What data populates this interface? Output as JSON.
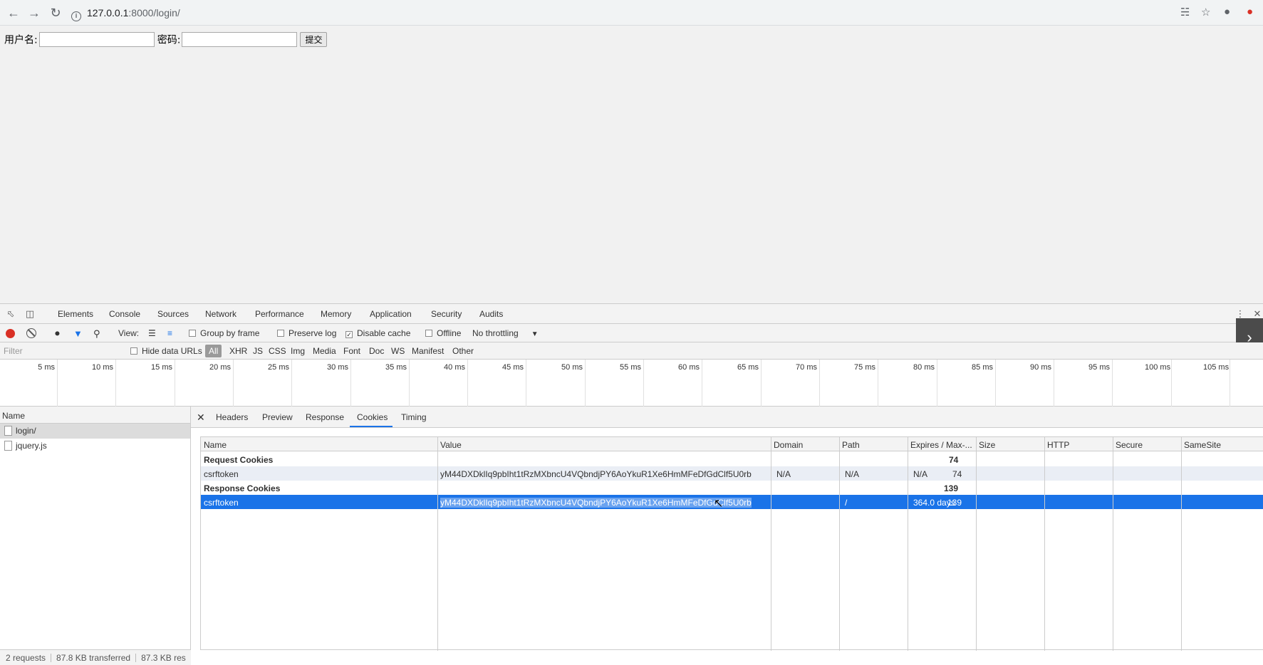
{
  "browser": {
    "url_host": "127.0.0.1",
    "url_path": ":8000/login/"
  },
  "login_form": {
    "username_label": "用户名:",
    "password_label": "密码:",
    "submit_label": "提交"
  },
  "devtools": {
    "tabs": [
      "Elements",
      "Console",
      "Sources",
      "Network",
      "Performance",
      "Memory",
      "Application",
      "Security",
      "Audits"
    ],
    "active_tab": "Network",
    "toolbar": {
      "view_label": "View:",
      "group_by_frame": "Group by frame",
      "preserve_log": "Preserve log",
      "disable_cache": "Disable cache",
      "disable_cache_checked": true,
      "offline": "Offline",
      "throttling": "No throttling"
    },
    "filter": {
      "placeholder": "Filter",
      "hide_data_urls": "Hide data URLs",
      "types": [
        "All",
        "XHR",
        "JS",
        "CSS",
        "Img",
        "Media",
        "Font",
        "Doc",
        "WS",
        "Manifest",
        "Other"
      ],
      "active_type": "All"
    },
    "timeline_ticks": [
      "5 ms",
      "10 ms",
      "15 ms",
      "20 ms",
      "25 ms",
      "30 ms",
      "35 ms",
      "40 ms",
      "45 ms",
      "50 ms",
      "55 ms",
      "60 ms",
      "65 ms",
      "70 ms",
      "75 ms",
      "80 ms",
      "85 ms",
      "90 ms",
      "95 ms",
      "100 ms",
      "105 ms"
    ],
    "requests": {
      "header": "Name",
      "items": [
        "login/",
        "jquery.js"
      ],
      "selected": "login/"
    },
    "status": {
      "requests": "2 requests",
      "transferred": "87.8 KB transferred",
      "resources": "87.3 KB res"
    },
    "detail_tabs": [
      "Headers",
      "Preview",
      "Response",
      "Cookies",
      "Timing"
    ],
    "active_detail_tab": "Cookies",
    "cookies": {
      "columns": [
        "Name",
        "Value",
        "Domain",
        "Path",
        "Expires / Max-...",
        "Size",
        "HTTP",
        "Secure",
        "SameSite"
      ],
      "request_section": {
        "label": "Request Cookies",
        "size": "74"
      },
      "request_rows": [
        {
          "name": "csrftoken",
          "value": "yM44DXDklIq9pbIht1tRzMXbncU4VQbndjPY6AoYkuR1Xe6HmMFeDfGdClf5U0rb",
          "domain": "N/A",
          "path": "N/A",
          "expires": "N/A",
          "size": "74"
        }
      ],
      "response_section": {
        "label": "Response Cookies",
        "size": "139"
      },
      "response_rows": [
        {
          "name": "csrftoken",
          "value": "yM44DXDklIq9pbIht1tRzMXbncU4VQbndjPY6AoYkuR1Xe6HmMFeDfGdClf5U0rb",
          "domain": "",
          "path": "/",
          "expires": "364.0 days",
          "size": "139"
        }
      ]
    }
  },
  "colors": {
    "accent": "#1a73e8",
    "record": "#d93025"
  }
}
